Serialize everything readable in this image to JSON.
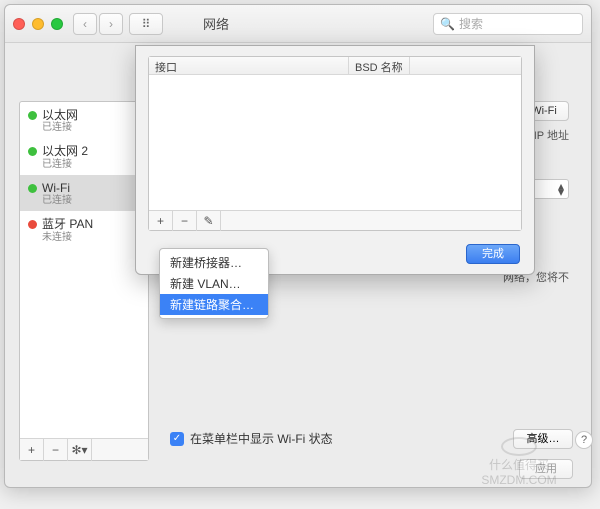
{
  "window": {
    "title": "网络",
    "search_placeholder": "搜索"
  },
  "sidebar": {
    "items": [
      {
        "name": "以太网",
        "status": "已连接",
        "color": "green"
      },
      {
        "name": "以太网 2",
        "status": "已连接",
        "color": "green"
      },
      {
        "name": "Wi-Fi",
        "status": "已连接",
        "color": "green",
        "selected": true
      },
      {
        "name": "蓝牙 PAN",
        "status": "未连接",
        "color": "red"
      }
    ]
  },
  "right": {
    "wifi_off": "关闭 Wi-Fi",
    "ip_text": "，其 IP 地址",
    "net_warn": "网络，您将不"
  },
  "checkbox": {
    "label": "在菜单栏中显示 Wi-Fi 状态"
  },
  "advanced": {
    "label": "高级…"
  },
  "apply": {
    "label": "应用"
  },
  "sheet": {
    "col1": "接口",
    "col2": "BSD 名称",
    "done": "完成"
  },
  "menu": {
    "items": [
      "新建桥接器…",
      "新建 VLAN…",
      "新建链路聚合…"
    ]
  },
  "watermark": {
    "text": "什么值得买",
    "sub": "SMZDM.COM"
  }
}
